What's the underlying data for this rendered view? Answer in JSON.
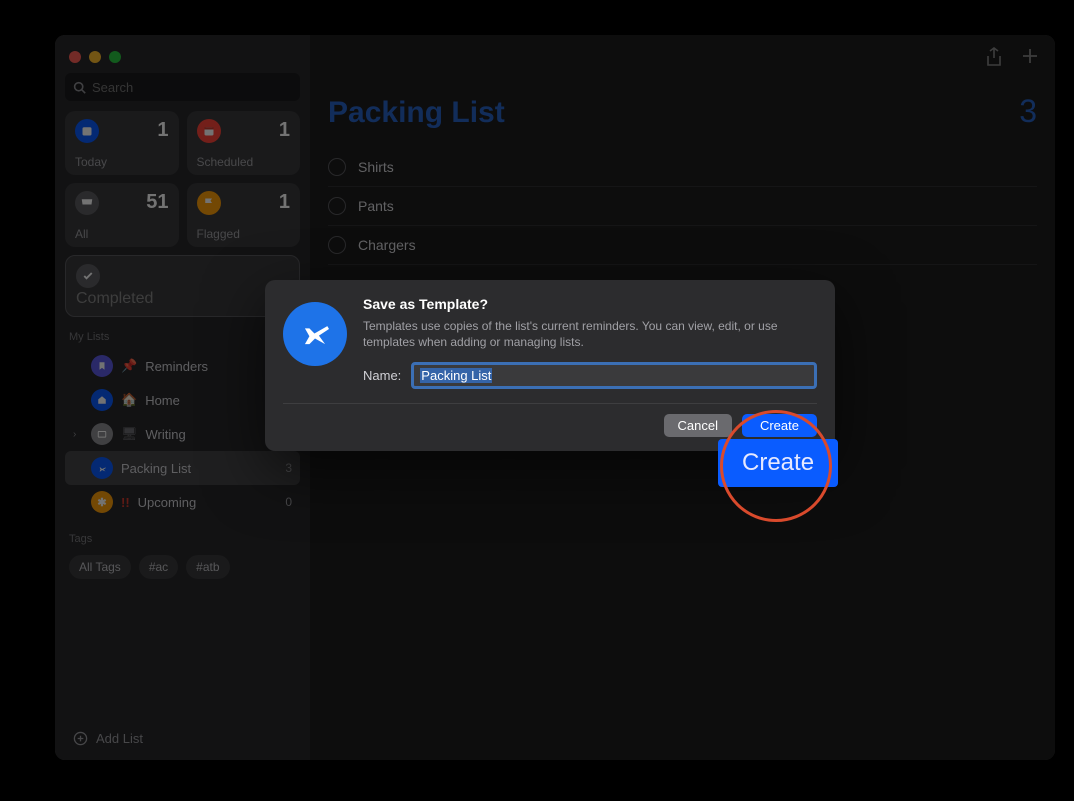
{
  "search": {
    "placeholder": "Search"
  },
  "tiles": {
    "today": {
      "label": "Today",
      "count": "1",
      "color": "#0a5cff"
    },
    "scheduled": {
      "label": "Scheduled",
      "count": "1",
      "color": "#ff453a"
    },
    "all": {
      "label": "All",
      "count": "51",
      "color": "#5e5e63"
    },
    "flagged": {
      "label": "Flagged",
      "count": "1",
      "color": "#ff9f0a"
    },
    "completed": {
      "label": "Completed"
    }
  },
  "sections": {
    "mylists": {
      "title": "My Lists"
    },
    "tags": {
      "title": "Tags"
    }
  },
  "lists": [
    {
      "name": "Reminders",
      "count": "",
      "color": "#5e5ce6",
      "icon": "bookmark"
    },
    {
      "name": "Home",
      "count": "",
      "color": "#0a5cff",
      "icon": "home"
    },
    {
      "name": "Writing",
      "count": "",
      "color": "#8e8e93",
      "icon": "folder",
      "expandable": true
    },
    {
      "name": "Packing List",
      "count": "3",
      "color": "#0a5cff",
      "icon": "plane",
      "active": true
    },
    {
      "name": "Upcoming",
      "count": "0",
      "color": "#ff9f0a",
      "icon": "asterisk"
    }
  ],
  "tags": [
    "All Tags",
    "#ac",
    "#atb"
  ],
  "addlist": "Add List",
  "main": {
    "title": "Packing List",
    "count": "3",
    "items": [
      "Shirts",
      "Pants",
      "Chargers"
    ]
  },
  "modal": {
    "title": "Save as Template?",
    "description": "Templates use copies of the list's current reminders. You can view, edit, or use templates when adding or managing lists.",
    "name_label": "Name:",
    "name_value": "Packing List",
    "cancel": "Cancel",
    "create": "Create"
  },
  "ring_label": "Create"
}
